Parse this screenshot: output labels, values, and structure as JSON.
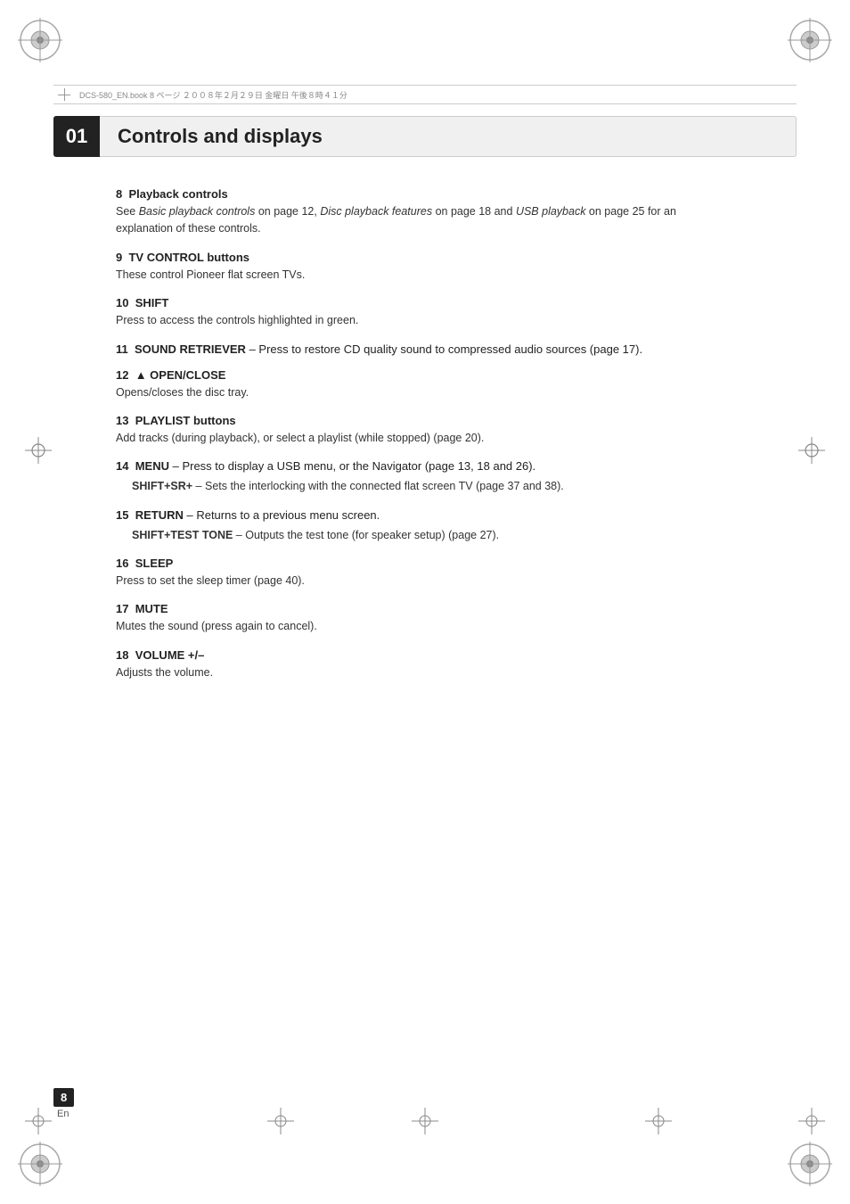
{
  "header": {
    "file_info": "DCS-580_EN.book  8 ページ  ２００８年２月２９日  金曜日  午後８時４１分"
  },
  "chapter": {
    "number": "01",
    "title": "Controls and displays"
  },
  "sections": [
    {
      "id": "8",
      "title": "8  Playback controls",
      "body": "See Basic playback controls on page 12, Disc playback features on page 18 and USB playback on page 25 for an explanation of these controls.",
      "italic_parts": [
        "Basic playback controls",
        "Disc playback features",
        "USB playback"
      ]
    },
    {
      "id": "9",
      "title": "9  TV CONTROL buttons",
      "body": "These control Pioneer flat screen TVs."
    },
    {
      "id": "10",
      "title": "10  SHIFT",
      "body": "Press to access the controls highlighted in green."
    },
    {
      "id": "11",
      "title": "11  SOUND RETRIEVER",
      "title_suffix": " – Press to restore CD quality sound to compressed audio sources (page 17)."
    },
    {
      "id": "12",
      "title": "12  ▲ OPEN/CLOSE",
      "body": "Opens/closes the disc tray."
    },
    {
      "id": "13",
      "title": "13  PLAYLIST buttons",
      "body": "Add tracks (during playback), or select a playlist (while stopped) (page 20)."
    },
    {
      "id": "14",
      "title": "14  MENU",
      "title_suffix": " – Press to display a USB menu, or the Navigator (page 13, 18 and 26).",
      "sub_item": {
        "title": "SHIFT+SR+",
        "body": " – Sets the interlocking with the connected flat screen TV (page 37 and 38)."
      }
    },
    {
      "id": "15",
      "title": "15  RETURN",
      "title_suffix": " – Returns to a previous menu screen.",
      "sub_item": {
        "title": "SHIFT+TEST TONE",
        "body": " – Outputs the test tone (for speaker setup) (page 27)."
      }
    },
    {
      "id": "16",
      "title": "16  SLEEP",
      "body": "Press to set the sleep timer (page 40)."
    },
    {
      "id": "17",
      "title": "17  MUTE",
      "body": "Mutes the sound (press again to cancel)."
    },
    {
      "id": "18",
      "title": "18  VOLUME +/–",
      "body": "Adjusts the volume."
    }
  ],
  "page": {
    "number": "8",
    "language": "En"
  }
}
